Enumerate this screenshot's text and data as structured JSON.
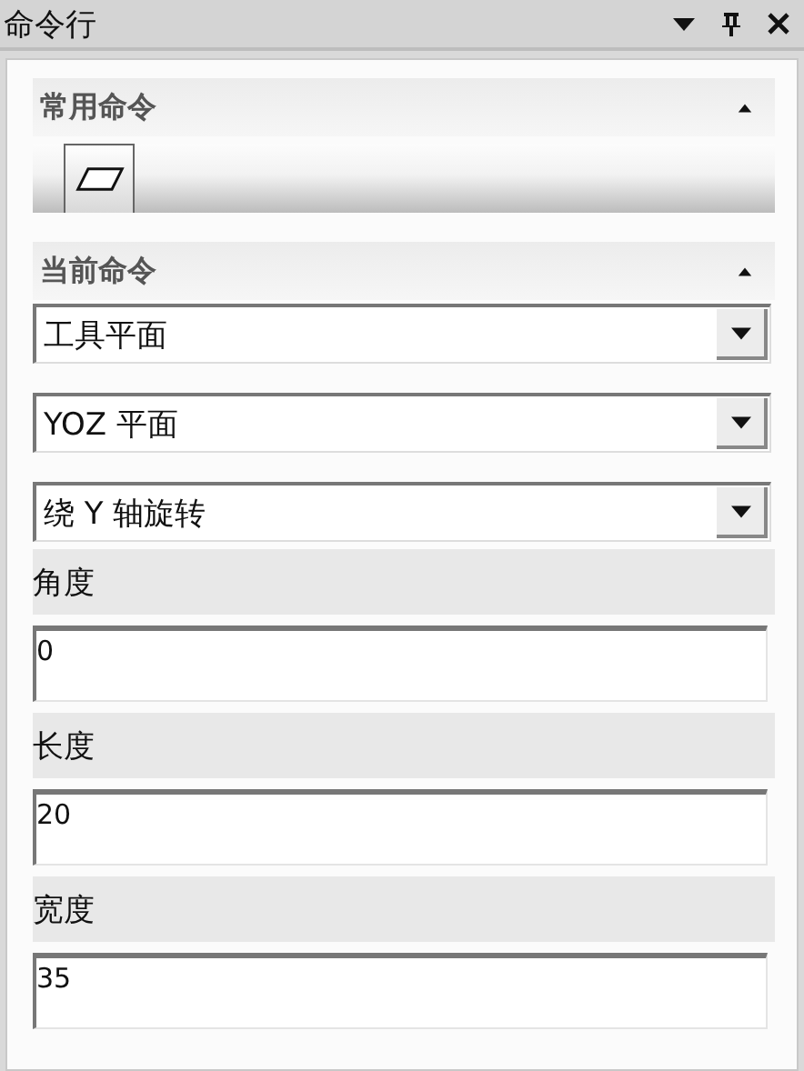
{
  "window": {
    "title": "命令行"
  },
  "sections": [
    {
      "title": "常用命令",
      "expanded": true,
      "kind": "toolbar",
      "tools": [
        {
          "kind": "parallelogram",
          "selected": true
        }
      ]
    },
    {
      "title": "当前命令",
      "expanded": true,
      "kind": "form",
      "items": [
        {
          "kind": "dropdown",
          "value": "工具平面"
        },
        {
          "kind": "dropdown",
          "value": "YOZ 平面"
        },
        {
          "kind": "dropdown",
          "value": "绕 Y 轴旋转"
        },
        {
          "kind": "label",
          "text": "角度"
        },
        {
          "kind": "input",
          "value": "0"
        },
        {
          "kind": "label",
          "text": "长度"
        },
        {
          "kind": "input",
          "value": "20"
        },
        {
          "kind": "label",
          "text": "宽度"
        },
        {
          "kind": "input",
          "value": "35"
        }
      ]
    }
  ]
}
